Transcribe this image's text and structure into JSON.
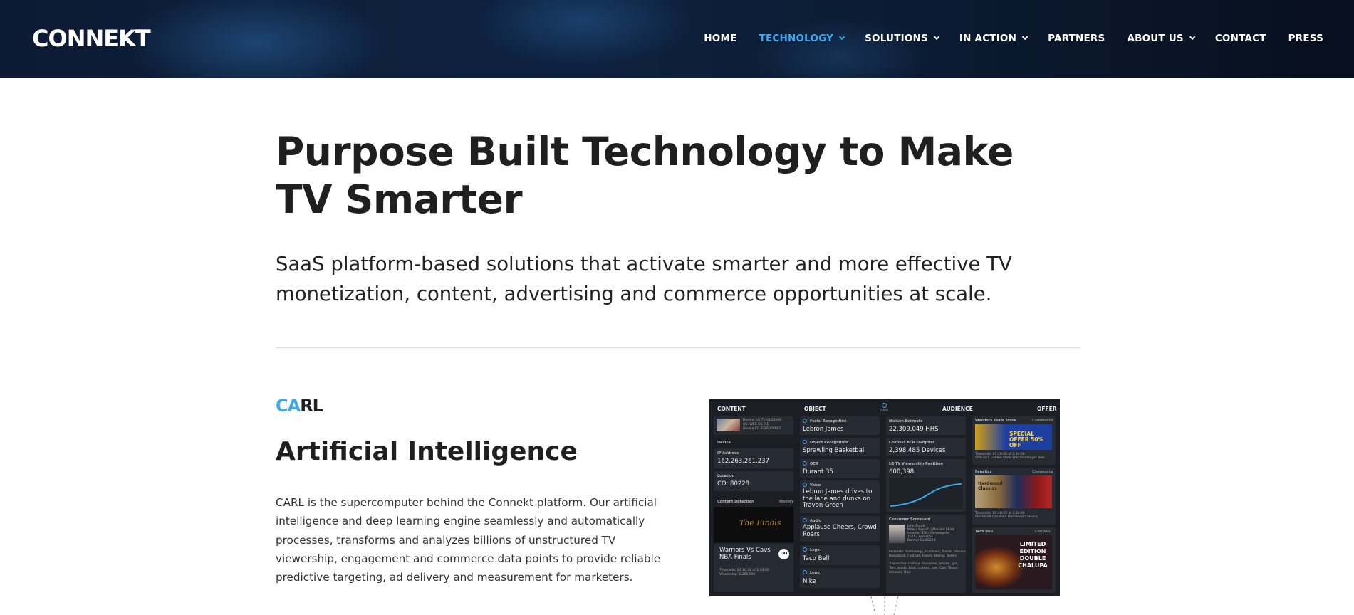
{
  "header": {
    "logo_text": "CONNEKT",
    "nav": [
      {
        "label": "HOME",
        "dropdown": false,
        "active": false
      },
      {
        "label": "TECHNOLOGY",
        "dropdown": true,
        "active": true
      },
      {
        "label": "SOLUTIONS",
        "dropdown": true,
        "active": false
      },
      {
        "label": "IN ACTION",
        "dropdown": true,
        "active": false
      },
      {
        "label": "PARTNERS",
        "dropdown": false,
        "active": false
      },
      {
        "label": "ABOUT US",
        "dropdown": true,
        "active": false
      },
      {
        "label": "CONTACT",
        "dropdown": false,
        "active": false
      },
      {
        "label": "PRESS",
        "dropdown": false,
        "active": false
      }
    ]
  },
  "hero": {
    "title_line1": "Purpose Built Technology to Make",
    "title_line2": "TV Smarter",
    "subtitle_line1": "SaaS platform-based solutions that activate smarter and more effective TV",
    "subtitle_line2": "monetization, content, advertising and commerce opportunities at scale."
  },
  "carl": {
    "label_highlight": "CA",
    "label_rest": "RL",
    "title": "Artificial Intelligence",
    "body_lines": [
      "CARL is the supercomputer behind the Connekt platform. Our artificial",
      "intelligence and deep learning engine seamlessly and automatically",
      "processes, transforms and analyzes billions of unstructured TV",
      "viewership, engagement and commerce data points to provide reliable",
      "predictive targeting, ad delivery and measurement for marketers."
    ]
  },
  "dashboard": {
    "headers": {
      "content": "CONTENT",
      "object": "OBJECT",
      "carl": "CARL",
      "audience": "AUDIENCE",
      "offer": "OFFER"
    },
    "content": {
      "device_info": [
        "Device: LG TV OLD4006",
        "OS: WEB OS 3.1",
        "Device ID: 9780000987"
      ],
      "device_label": "Device",
      "ip_label": "IP Address",
      "ip_value": "162.263.261.237",
      "location_label": "Location",
      "location_value": "CO: 80228",
      "detection_label": "Content Detection",
      "history_label": "History",
      "finals_text": "The Finals",
      "program_line1": "Warriors Vs Cavs",
      "program_line2": "NBA Finals",
      "network_badge": "TNT",
      "timecode": "Timecode: 01:10:32 of 2:30:00",
      "viewership": "Viewership: 1,265,996"
    },
    "object": [
      {
        "label": "Facial Recognition",
        "value": "Lebron James"
      },
      {
        "label": "Object Recognition",
        "value": "Sprawling Basketball"
      },
      {
        "label": "OCR",
        "value": "Durant 35"
      },
      {
        "label": "Voice",
        "value": "Lebron James drives to the lane and dunks on Travon Green"
      },
      {
        "label": "Audio",
        "value": "Applause Cheers, Crowd Roars"
      },
      {
        "label": "Logo",
        "value": "Taco Bell"
      },
      {
        "label": "Logo",
        "value": "Nike"
      }
    ],
    "audience": {
      "nielsen_label": "Nielsen Estimate",
      "nielsen_value": "22,309,049 HHS",
      "acr_label": "Connekt ACR Footprint",
      "acr_value": "2,398,485 Devices",
      "realtime_label": "LG TV Viewership Realtime",
      "realtime_value": "600,398",
      "scorecard_label": "Consumer Scorecard",
      "scorecard_info": [
        "John Smith",
        "Male | Age 40 | Married | Kids",
        "Income: 85k | Homeowner",
        "75752 Forest St",
        "Denver Co 80228"
      ],
      "interests": [
        "Interests: Technology, Outdoors, Travel, Fashion,",
        "Basketball, Football, Family, Biking, Tennis"
      ],
      "transactions": [
        "Transaction History: Groceries, iphone, gas,",
        "Tent, boots, boat, clothes, bait, Cap, Target,",
        "Amazon, Nike"
      ]
    },
    "offer": [
      {
        "label": "Warriors Team Store",
        "tag": "Commerce",
        "banner": "SPECIAL OFFER 50% OFF",
        "lines": [
          "Timecode: 01:10:32 of 2:30:00",
          "50% OFF Golden State Warriors Player Tees"
        ]
      },
      {
        "label": "Fanatics",
        "tag": "Commerce",
        "banner": "Hardwood Classics",
        "lines": [
          "Timecode: 01:10:32 of 2:30:00",
          "Cleveland Cavaliers Hardwood Classics"
        ]
      },
      {
        "label": "Taco Bell",
        "tag": "Coupon",
        "banner": "LIMITED EDITION DOUBLE CHALUPA",
        "lines": []
      }
    ]
  },
  "colors": {
    "accent": "#3ea8ec",
    "header_bg": "#0e2240",
    "dashboard_bg": "#1b1e24",
    "text_dark": "#1f1f1f"
  }
}
